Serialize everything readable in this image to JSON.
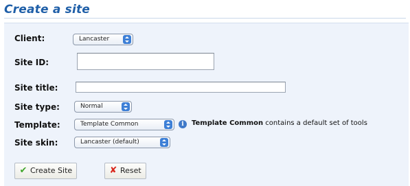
{
  "page": {
    "title": "Create a site"
  },
  "form": {
    "client": {
      "label": "Client:",
      "selected": "Lancaster"
    },
    "site_id": {
      "label": "Site ID:",
      "value": ""
    },
    "site_title": {
      "label": "Site title:",
      "value": ""
    },
    "site_type": {
      "label": "Site type:",
      "selected": "Normal"
    },
    "template": {
      "label": "Template:",
      "selected": "Template Common",
      "info_name": "Template Common",
      "info_text": " contains a default set of tools"
    },
    "site_skin": {
      "label": "Site skin:",
      "selected": "Lancaster (default)"
    }
  },
  "buttons": {
    "create": "Create Site",
    "reset": "Reset"
  },
  "icons": {
    "select_arrows": "select-arrows-icon",
    "info": "info-icon",
    "create": "check-icon",
    "reset": "cross-icon"
  },
  "colors": {
    "title": "#1f5fa8",
    "panel": "#eef3fb",
    "select_arrows": "#3d7fd6",
    "check": "#3fa52a",
    "cross": "#d9261c"
  }
}
